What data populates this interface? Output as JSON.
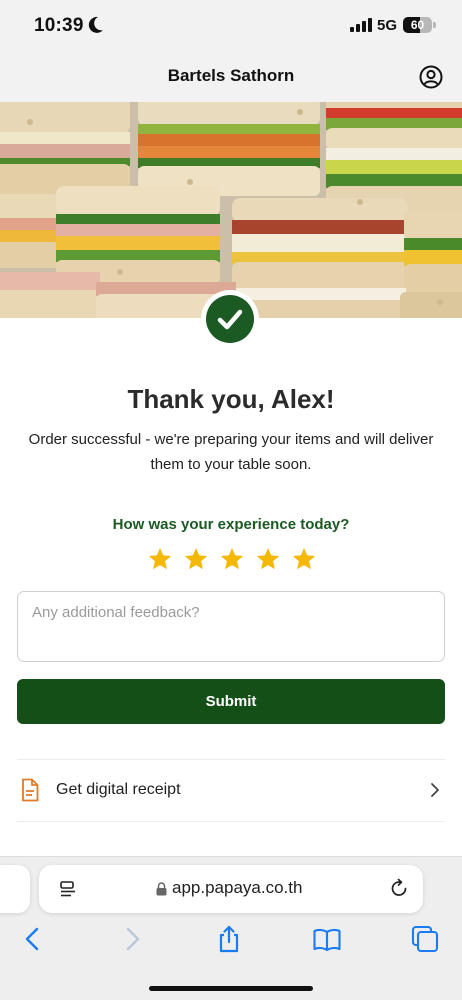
{
  "status_bar": {
    "time": "10:39",
    "network": "5G",
    "battery": "60",
    "battery_level": 0.6
  },
  "header": {
    "title": "Bartels Sathorn",
    "account_icon": "account-circle-icon"
  },
  "hero": {
    "image": "sandwich-platter-photo",
    "badge_icon": "checkmark-icon"
  },
  "confirmation": {
    "title": "Thank you, Alex!",
    "message": "Order successful - we're preparing your items and will deliver them to your table soon."
  },
  "rating": {
    "question": "How was your experience today?",
    "stars_total": 5,
    "stars_selected": 5,
    "star_color": "#f5b800"
  },
  "feedback": {
    "placeholder": "Any additional feedback?",
    "value": ""
  },
  "submit": {
    "label": "Submit",
    "color": "#154f18"
  },
  "receipt": {
    "label": "Get digital receipt",
    "icon": "document-icon",
    "icon_color": "#e07b2c"
  },
  "browser": {
    "url": "app.papaya.co.th",
    "accent": "#1a7cf5"
  }
}
